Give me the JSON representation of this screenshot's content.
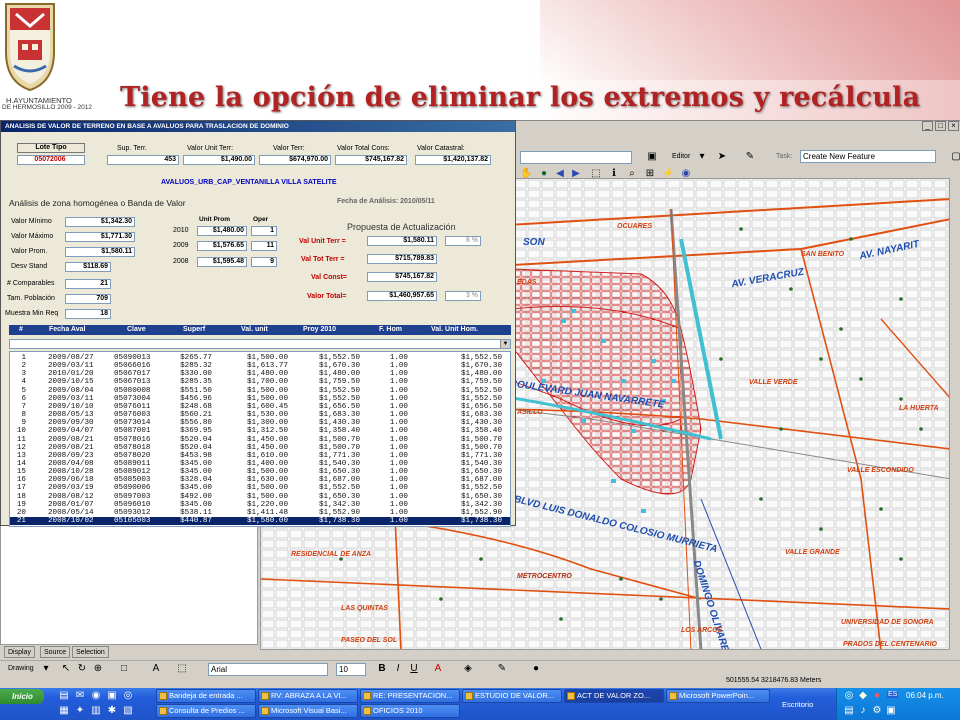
{
  "slide": {
    "title": "Tiene la opción de eliminar los extremos y recálcula",
    "org_line1": "H.AYUNTAMIENTO",
    "org_line2": "DE HERMOSILLO 2009 - 2012"
  },
  "app": {
    "editor_label": "Editor",
    "task_label": "Task:",
    "task_value": "Create New Feature",
    "coords": "501555.54  3218476.83 Meters",
    "drawing_label": "Drawing",
    "font_name": "Arial",
    "font_size": "10",
    "panel_tabs": [
      "Display",
      "Source",
      "Selection"
    ]
  },
  "map": {
    "streets": [
      "AV. NAYARIT",
      "AV. VERACRUZ",
      "BOULEVARD JUAN NAVARRETE",
      "BLVD LUIS DONALDO COLOSIO MURRIETA",
      "DOMINGO OLIVARES",
      "SON"
    ],
    "labels": [
      "OCUARES",
      "SAN BENITO",
      "VALLE VERDE",
      "LA HUERTA",
      "VALLE ESCONDIDO",
      "VALLE GRANDE",
      "RESIDENCIAL DE ANZA",
      "METROCENTRO",
      "LAS QUINTAS",
      "PASEO DEL SOL",
      "LOS ARCOS",
      "UNIVERSIDAD DE SONORA",
      "PRADOS DEL CENTENARIO",
      "EDAS",
      "ASILLO"
    ]
  },
  "dialog": {
    "title": "ANALISIS DE VALOR DE TERRENO EN BASE A AVALUOS PARA TRASLACION DE DOMINIO",
    "lote_tipo_label": "Lote Tipo",
    "lote_tipo_value": "05072006",
    "sup_terr_label": "Sup. Terr.",
    "sup_terr_value": "453",
    "valor_unit_terr_label": "Valor Unit Terr:",
    "valor_unit_terr_value": "$1,490.00",
    "valor_terr_label": "Valor Terr:",
    "valor_terr_value": "$674,970.00",
    "valor_total_cons_label": "Valor Total Cons:",
    "valor_total_cons_value": "$745,167.82",
    "valor_catastral_label": "Valor Catastral:",
    "valor_catastral_value": "$1,420,137.82",
    "avaluos_name": "AVALUOS_URB_CAP_VENTANILLA VILLA SATELITE",
    "analysis_heading": "Análisis de zona homogénea o Banda de Valor",
    "fecha_analisis": "Fecha de Análisis: 2010/05/11",
    "stats": [
      {
        "label": "Valor Mínimo",
        "value": "$1,342.30"
      },
      {
        "label": "Valor Máximo",
        "value": "$1,771.30"
      },
      {
        "label": "Valor Prom.",
        "value": "$1,580.11"
      },
      {
        "label": "Desv Stand",
        "value": "$118.69"
      },
      {
        "label": "# Comparables",
        "value": "21"
      },
      {
        "label": "Tam. Población",
        "value": "709"
      },
      {
        "label": "Muestra Min Req",
        "value": "18"
      }
    ],
    "unit_prom_label": "Unit Prom",
    "oper_label": "Oper",
    "years": [
      {
        "year": "2010",
        "value": "$1,480.00",
        "oper": "1"
      },
      {
        "year": "2009",
        "value": "$1,576.65",
        "oper": "11"
      },
      {
        "year": "2008",
        "value": "$1,595.48",
        "oper": "9"
      }
    ],
    "propuesta_heading": "Propuesta de Actualización",
    "propuesta": [
      {
        "label": "Val Unit Terr =",
        "value": "$1,580.11",
        "pct": "6 %"
      },
      {
        "label": "Val Tot Terr =",
        "value": "$715,789.83",
        "pct": ""
      },
      {
        "label": "Val  Const=",
        "value": "$745,167.82",
        "pct": ""
      },
      {
        "label": "Valor Total=",
        "value": "$1,460,957.65",
        "pct": "3 %"
      }
    ],
    "columns": [
      "#",
      "Fecha Aval",
      "Clave",
      "Superf",
      "Val. unit",
      "Proy  2010",
      "F. Hom",
      "Val. Unit Hom."
    ],
    "rows": [
      [
        "1",
        "2009/08/27",
        "05090013",
        "$265.77",
        "$1,500.00",
        "$1,552.50",
        "1.00",
        "$1,552.50"
      ],
      [
        "2",
        "2009/03/11",
        "05066016",
        "$285.32",
        "$1,613.77",
        "$1,670.30",
        "1.00",
        "$1,670.30"
      ],
      [
        "3",
        "2010/01/20",
        "05067017",
        "$330.00",
        "$1,480.00",
        "$1,480.00",
        "1.00",
        "$1,480.00"
      ],
      [
        "4",
        "2009/10/15",
        "05067013",
        "$285.35",
        "$1,700.00",
        "$1,759.50",
        "1.00",
        "$1,759.50"
      ],
      [
        "5",
        "2009/08/04",
        "05080008",
        "$551.50",
        "$1,500.00",
        "$1,552.50",
        "1.00",
        "$1,552.50"
      ],
      [
        "6",
        "2009/03/11",
        "05073004",
        "$456.96",
        "$1,500.00",
        "$1,552.50",
        "1.00",
        "$1,552.50"
      ],
      [
        "7",
        "2009/10/10",
        "05076011",
        "$248.68",
        "$1,600.45",
        "$1,656.50",
        "1.00",
        "$1,656.50"
      ],
      [
        "8",
        "2008/05/13",
        "05076003",
        "$560.21",
        "$1,530.00",
        "$1,683.30",
        "1.00",
        "$1,683.30"
      ],
      [
        "9",
        "2009/09/30",
        "05073014",
        "$556.80",
        "$1,300.00",
        "$1,430.30",
        "1.00",
        "$1,430.30"
      ],
      [
        "10",
        "2009/04/07",
        "05087001",
        "$369.95",
        "$1,312.50",
        "$1,358.40",
        "1.00",
        "$1,358.40"
      ],
      [
        "11",
        "2009/08/21",
        "05078016",
        "$520.04",
        "$1,450.00",
        "$1,500.70",
        "1.00",
        "$1,500.70"
      ],
      [
        "12",
        "2009/08/21",
        "05078018",
        "$520.04",
        "$1,450.00",
        "$1,500.70",
        "1.00",
        "$1,500.70"
      ],
      [
        "13",
        "2008/09/23",
        "05078020",
        "$453.98",
        "$1,610.00",
        "$1,771.30",
        "1.00",
        "$1,771.30"
      ],
      [
        "14",
        "2008/04/08",
        "05089011",
        "$345.00",
        "$1,400.00",
        "$1,540.30",
        "1.00",
        "$1,540.30"
      ],
      [
        "15",
        "2008/10/28",
        "05089012",
        "$345.00",
        "$1,500.00",
        "$1,650.30",
        "1.00",
        "$1,650.30"
      ],
      [
        "16",
        "2009/06/18",
        "05085003",
        "$328.04",
        "$1,630.00",
        "$1,687.00",
        "1.00",
        "$1,687.00"
      ],
      [
        "17",
        "2009/03/19",
        "05090006",
        "$345.00",
        "$1,500.00",
        "$1,552.50",
        "1.00",
        "$1,552.50"
      ],
      [
        "18",
        "2008/08/12",
        "05097003",
        "$492.00",
        "$1,500.00",
        "$1,650.30",
        "1.00",
        "$1,650.30"
      ],
      [
        "19",
        "2008/01/07",
        "05096010",
        "$345.00",
        "$1,220.00",
        "$1,342.30",
        "1.00",
        "$1,342.30"
      ],
      [
        "20",
        "2008/05/14",
        "05093012",
        "$538.11",
        "$1,411.48",
        "$1,552.90",
        "1.00",
        "$1,552.90"
      ],
      [
        "21",
        "2008/10/02",
        "05105003",
        "$440.87",
        "$1,580.00",
        "$1,738.30",
        "1.00",
        "$1,738.30"
      ]
    ],
    "selected_row": 20
  },
  "taskbar": {
    "start_label": "Inicio",
    "tasks_row1": [
      "Bandeja de entrada ...",
      "RV: ABRAZA A LA VI...",
      "RE: PRESENTACION...",
      "ESTUDIO DE VALOR...",
      "ACT DE VALOR ZO...",
      "Microsoft PowerPoin..."
    ],
    "tasks_row2": [
      "Consulta de Predios ...",
      "Microsoft Visual Basi...",
      "OFICIOS 2010"
    ],
    "active_task": 4,
    "escritorio": "Escritorio",
    "lang": "ES",
    "clock": "06:04 p.m."
  }
}
